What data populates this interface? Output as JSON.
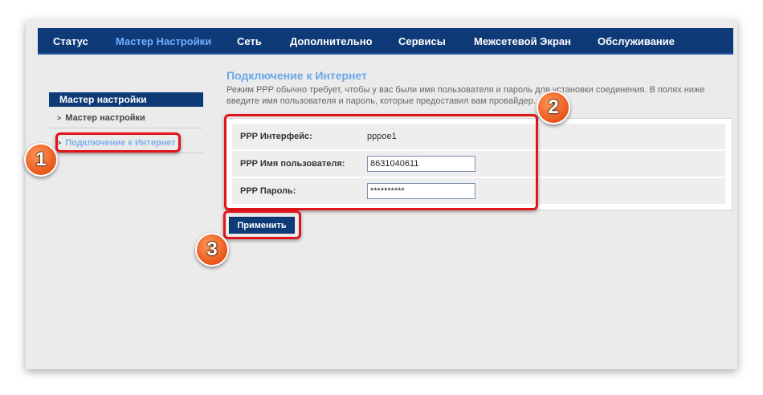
{
  "nav": {
    "items": [
      {
        "label": "Статус"
      },
      {
        "label": "Мастер Настройки"
      },
      {
        "label": "Сеть"
      },
      {
        "label": "Дополнительно"
      },
      {
        "label": "Сервисы"
      },
      {
        "label": "Межсетевой Экран"
      },
      {
        "label": "Обслуживание"
      }
    ],
    "active": "Мастер Настройки"
  },
  "sidebar": {
    "title": "Мастер настройки",
    "items": [
      {
        "label": "Мастер настройки"
      },
      {
        "label": "Подключение к Интернет"
      }
    ]
  },
  "main": {
    "title": "Подключение к Интернет",
    "description": "Режим PPP обычно требует, чтобы у вас были имя пользователя и пароль для установки соединения. В полях ниже введите имя пользователя и пароль, которые предоставил вам провайдер.",
    "rows": [
      {
        "label": "PPP Интерфейс:",
        "value": "pppoe1"
      },
      {
        "label": "PPP Имя пользователя:",
        "value": "8631040611"
      },
      {
        "label": "PPP Пароль:",
        "value": "**********"
      }
    ],
    "apply_label": "Применить"
  },
  "annotations": {
    "badges": [
      "1",
      "2",
      "3"
    ],
    "highlight_color": "#e0141b",
    "badge_color": "#e85518"
  },
  "colors": {
    "nav_bg": "#0e3a77",
    "nav_active": "#6fb0ff",
    "title": "#6aa7e8"
  }
}
